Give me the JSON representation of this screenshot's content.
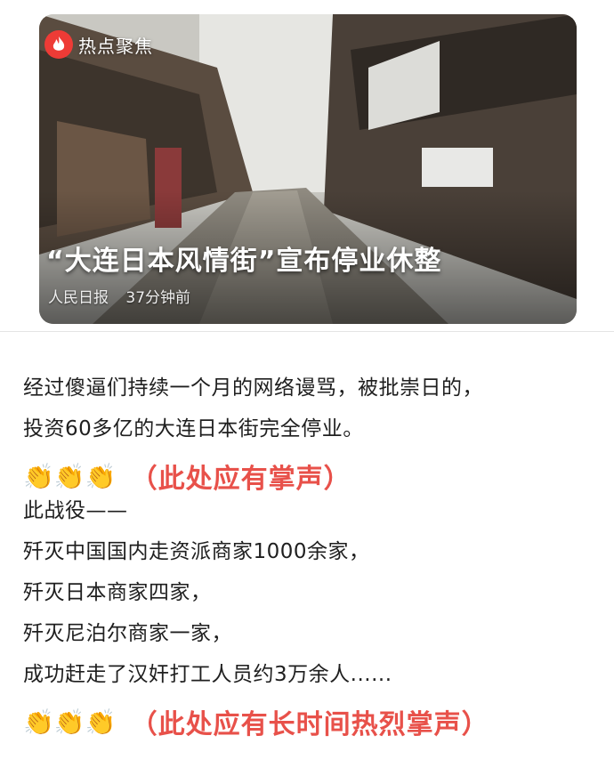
{
  "news_card": {
    "tag": "热点聚焦",
    "headline": "“大连日本风情街”宣布停业休整",
    "source": "人民日报",
    "time": "37分钟前"
  },
  "paragraphs": [
    "经过傻逼们持续一个月的网络谩骂，被批崇日的，",
    "投资60多亿的大连日本街完全停业。"
  ],
  "applause_1": {
    "emoji": "👏👏👏",
    "text": "（此处应有掌声）"
  },
  "list_lines": [
    "此战役——",
    "歼灭中国国内走资派商家1000余家，",
    "歼灭日本商家四家，",
    "歼灭尼泊尔商家一家，",
    "成功赶走了汉奸打工人员约3万余人......"
  ],
  "applause_2": {
    "emoji": "👏👏👏",
    "text": "（此处应有长时间热烈掌声）"
  },
  "colors": {
    "accent_red": "#e8514a",
    "flame_red": "#ee3b36"
  }
}
